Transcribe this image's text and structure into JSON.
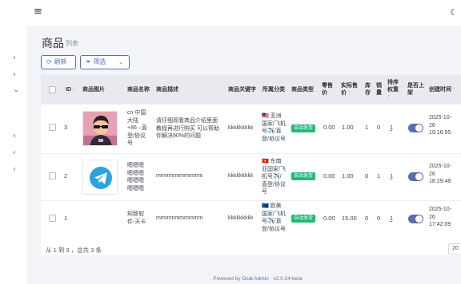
{
  "sidebar": {
    "chevrons": [
      "‹",
      "‹",
      "⌄",
      "‹",
      "‹",
      "‹"
    ]
  },
  "navbar": {
    "menu_icon": "≡",
    "theme_icon": "☾"
  },
  "page": {
    "title": "商品",
    "subtitle": "列表"
  },
  "toolbar": {
    "refresh_icon": "⟳",
    "refresh_label": "刷新",
    "filter_icon": "⏷",
    "filter_label": "筛选",
    "filter_caret": "⌄"
  },
  "table": {
    "columns": {
      "id": "ID",
      "id_sort": "↑",
      "image": "商品图片",
      "name": "商品名称",
      "desc": "商品描述",
      "keyword": "商品关键字",
      "category": "所属分类",
      "type": "商品类型",
      "retail_price_1": "零售",
      "retail_price_2": "价",
      "actual_price_1": "实际售",
      "actual_price_2": "价",
      "price_sort": "↑",
      "stock_1": "库",
      "stock_2": "存",
      "sales_1": "销",
      "sales_2": "量",
      "weight_1": "排序",
      "weight_2": "权重",
      "weight_sort": "↑",
      "listed_1": "是否上",
      "listed_2": "架",
      "created": "创建时间",
      "created_sort": "↑"
    },
    "rows": [
      {
        "id": "3",
        "name": "cn 中国大陆+86 -直登/协议号",
        "name_lines": [
          "cn 中国",
          "大陆",
          "+86 –直",
          "登/协议",
          "号"
        ],
        "desc_lines": [
          "请仔细观看商品介绍里面",
          "教程再进行购买 可以帮助",
          "你解决90%的问题"
        ],
        "keyword": "kkkkkkkkk",
        "category_lines": [
          "🇲🇾 亚洲",
          "国家/飞机",
          "号✈️/直",
          "登/协议号"
        ],
        "type": "自动发货",
        "retail_price": "0.00",
        "actual_price": "1.00",
        "stock": "1",
        "sales": "0",
        "weight": "1",
        "listed": true,
        "created_lines": [
          "2025-10-",
          "26",
          "19:16:55"
        ]
      },
      {
        "id": "2",
        "name_lines": [
          "嗯嗯嗯",
          "嗯嗯嗯",
          "嗯嗯嗯",
          "嗯嗯嗯"
        ],
        "desc_lines": [
          "mmmmmmmmmm"
        ],
        "keyword": "kkkkkkkkk",
        "category_lines": [
          "🇻🇳 东南",
          "亚国家/飞",
          "机号✈️/",
          "直登/协议",
          "号"
        ],
        "type": "自动发货",
        "retail_price": "0.00",
        "actual_price": "1.00",
        "stock": "0",
        "sales": "1",
        "weight": "1",
        "listed": true,
        "created_lines": [
          "2025-10-",
          "26",
          "18:29:48"
        ]
      },
      {
        "id": "1",
        "name_lines": [
          "知致软",
          "件-天卡"
        ],
        "desc_lines": [
          "mmmmmmmmmm"
        ],
        "keyword": "kkkkkkkkk",
        "category_lines": [
          "🇪🇺 欧美",
          "国家/飞机",
          "号✈️/直",
          "登/协议号"
        ],
        "type": "自动发货",
        "retail_price": "0.00",
        "actual_price": "15.00",
        "stock": "0",
        "sales": "0",
        "weight": "1",
        "listed": true,
        "created_lines": [
          "2025-10-",
          "26",
          "17:42:09"
        ]
      }
    ]
  },
  "pagination": {
    "info": "从 1 到 3 ，总共 3 条",
    "per_page": "20"
  },
  "footer": {
    "powered_prefix": "Powered by ",
    "powered_link": "Dcat Admin",
    "version": " · v2.0.24-beta"
  },
  "colors": {
    "accent": "#586cb1",
    "badge_green": "#21b978",
    "header_bg": "#e9eaf0",
    "content_bg": "#f3f4f8"
  }
}
